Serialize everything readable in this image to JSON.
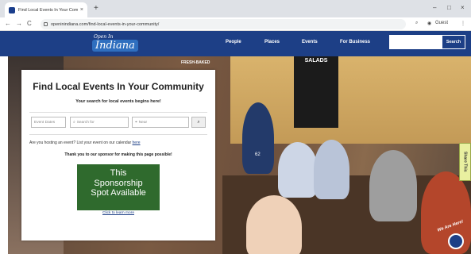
{
  "browser": {
    "tab_title": "Find Local Events In Your Commu",
    "tab_close": "×",
    "new_tab": "+",
    "url": "openinindiana.com/find-local-events-in-your-community/",
    "back": "←",
    "forward": "→",
    "reload": "C",
    "profile": "Guest",
    "minimize": "–",
    "maximize": "□",
    "close": "×"
  },
  "site": {
    "logo_line1": "Open In",
    "logo_line2": "Indiana",
    "nav": [
      "People",
      "Places",
      "Events",
      "For Business"
    ],
    "search_label": "Search"
  },
  "hero": {
    "sign_text": "SALADS",
    "wall_text": "FRESH-BAKED",
    "jersey": "62"
  },
  "card": {
    "title": "Find Local Events In Your Community",
    "subtitle": "Your search for local events begins here!",
    "event_dates_placeholder": "Event Dates",
    "search_for_placeholder": "Search for",
    "near_placeholder": "Near",
    "host_prompt": "Are you hosting an event? List your event on our calendar",
    "host_link": "here",
    "thanks": "Thank you to our sponsor for making this page possible!",
    "sponsor_line1": "This",
    "sponsor_line2": "Sponsorship",
    "sponsor_line3": "Spot Available",
    "learn_more": "Click to learn more"
  },
  "widgets": {
    "feedback": "Share This",
    "chat_label": "We Are Here!"
  },
  "colors": {
    "brand": "#1d3f86",
    "sponsor": "#2f6a2d"
  }
}
